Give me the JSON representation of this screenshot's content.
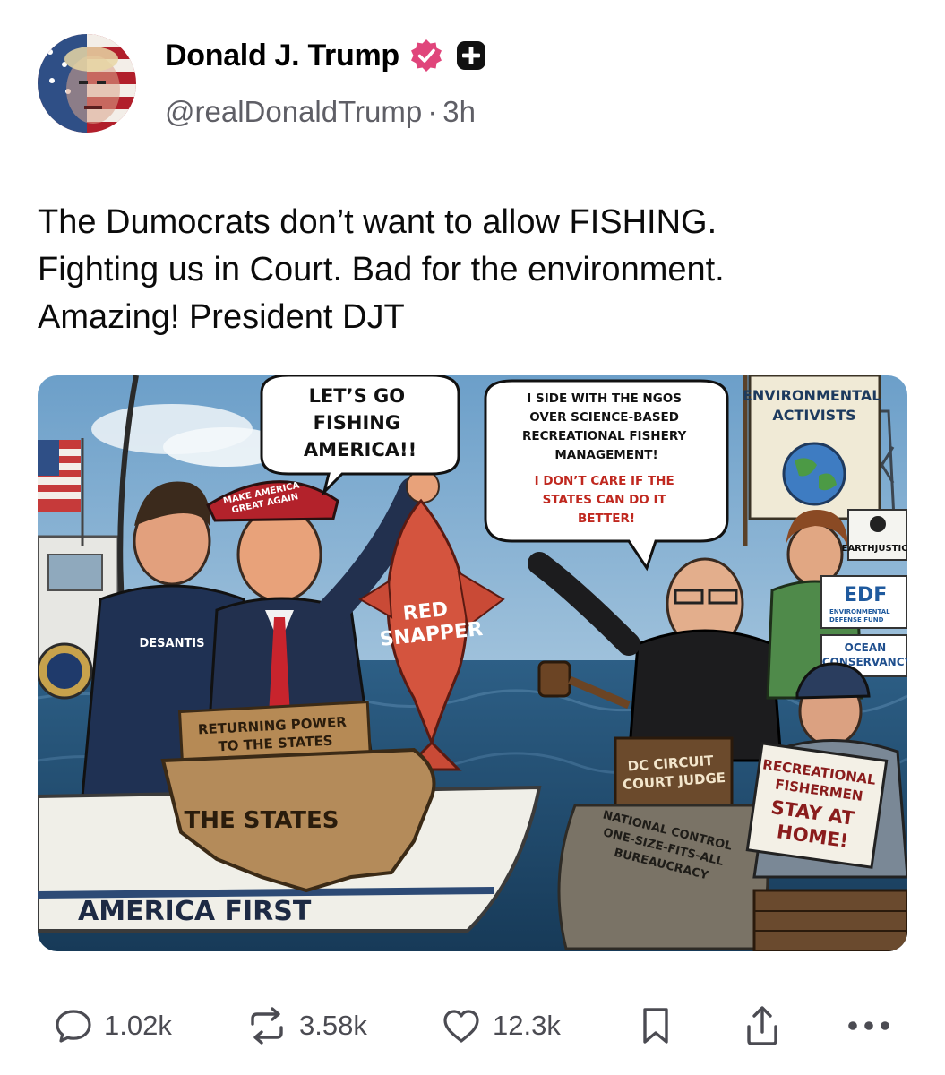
{
  "author": {
    "name": "Donald J. Trump",
    "handle": "@realDonaldTrump",
    "separator": "·",
    "time": "3h",
    "badges": [
      "verified-icon",
      "plus-icon"
    ]
  },
  "post": {
    "lines": [
      "The Dumocrats don’t want to allow FISHING.",
      "Fighting us in Court. Bad for the environment.",
      "Amazing! President DJT"
    ]
  },
  "image": {
    "speech_left": [
      "LET’S GO",
      "FISHING",
      "AMERICA!!"
    ],
    "speech_right": [
      "I SIDE WITH THE NGOS",
      "OVER SCIENCE-BASED",
      "RECREATIONAL FISHERY",
      "MANAGEMENT!"
    ],
    "speech_right_red": [
      "I DON’T CARE IF THE",
      "STATES CAN DO IT",
      "BETTER!"
    ],
    "hat": [
      "MAKE AMERICA",
      "GREAT AGAIN"
    ],
    "jacket": "DESANTIS",
    "fish": [
      "RED",
      "SNAPPER"
    ],
    "returning_sign": [
      "RETURNING POWER",
      "TO THE STATES"
    ],
    "states_label": "THE STATES",
    "boat_name": "AMERICA FIRST",
    "banner": [
      "ENVIRONMENTAL",
      "ACTIVISTS"
    ],
    "earthjustice": "EARTHJUSTICE",
    "edf": "EDF",
    "edf_sub": [
      "ENVIRONMENTAL",
      "DEFENSE FUND"
    ],
    "ocean": [
      "OCEAN",
      "CONSERVANCY"
    ],
    "judge_sign": [
      "DC CIRCUIT",
      "COURT JUDGE"
    ],
    "bureaucracy": [
      "NATIONAL CONTROL",
      "ONE-SIZE-FITS-ALL",
      "BUREAUCRACY"
    ],
    "fishermen_sign": [
      "RECREATIONAL",
      "FISHERMEN",
      "STAY AT",
      "HOME!"
    ]
  },
  "actions": {
    "replies": "1.02k",
    "reposts": "3.58k",
    "likes": "12.3k"
  },
  "colors": {
    "accent_pink": "#e0457b",
    "text_secondary": "#5f5f66",
    "icon_gray": "#4b4b52"
  }
}
